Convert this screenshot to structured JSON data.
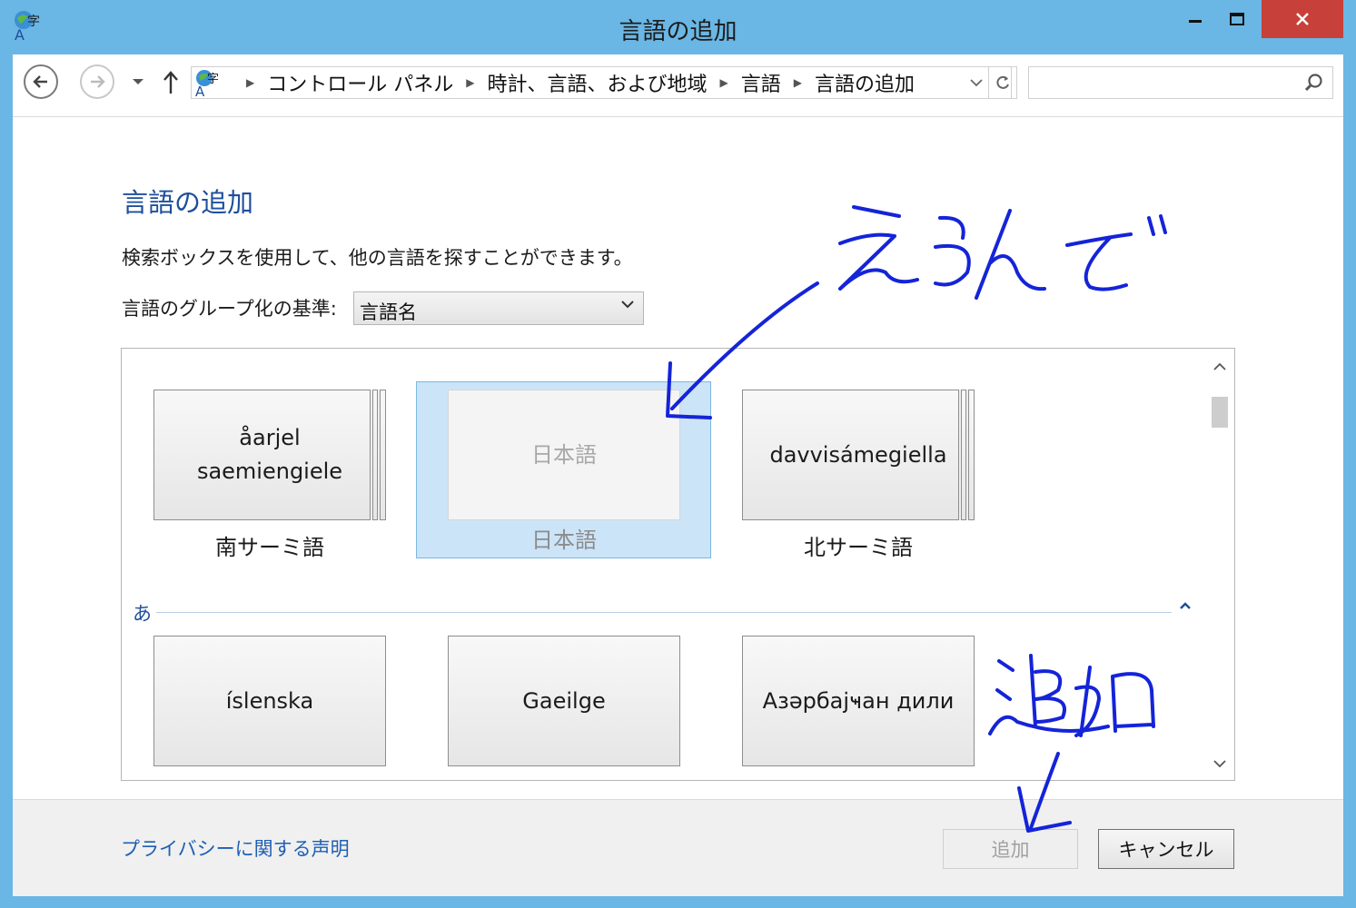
{
  "window": {
    "title": "言語の追加",
    "colors": {
      "frame": "#6ab6e4",
      "close": "#c8403a",
      "accent": "#1e4f9c"
    }
  },
  "navbar": {
    "breadcrumbs": [
      "コントロール パネル",
      "時計、言語、および地域",
      "言語",
      "言語の追加"
    ],
    "search_placeholder": ""
  },
  "page": {
    "title": "言語の追加",
    "description": "検索ボックスを使用して、他の言語を探すことができます。",
    "group_by_label": "言語のグループ化の基準:",
    "group_by_value": "言語名"
  },
  "languages_row1": [
    {
      "native": "åarjel saemiengiele",
      "native_line1": "åarjel",
      "native_line2": "saemiengiele",
      "label": "南サーミ語",
      "selected": false
    },
    {
      "native": "日本語",
      "label": "日本語",
      "selected": true
    },
    {
      "native": "davvisámegiella",
      "label": "北サーミ語",
      "selected": false
    }
  ],
  "group_header": "あ",
  "languages_row2": [
    {
      "native": "íslenska"
    },
    {
      "native": "Gaeilge"
    },
    {
      "native": "Азәрбајҹан дили"
    }
  ],
  "footer": {
    "privacy_link": "プライバシーに関する声明",
    "add_button": "追加",
    "cancel_button": "キャンセル"
  },
  "annotations": {
    "top_note": "えらんで",
    "bottom_note": "追加"
  }
}
